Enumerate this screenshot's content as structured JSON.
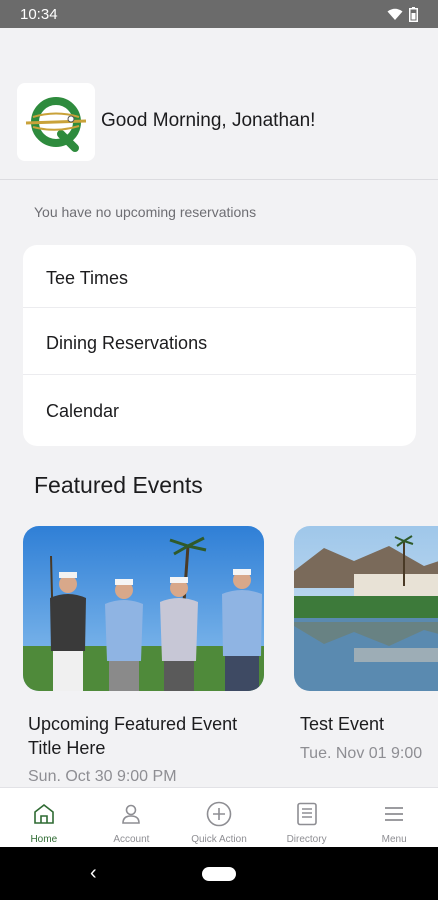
{
  "status_bar": {
    "time": "10:34",
    "icons": [
      "wifi-icon",
      "battery-icon"
    ]
  },
  "header": {
    "greeting": "Good Morning, Jonathan!",
    "logo": "club-logo"
  },
  "reservations": {
    "empty_text": "You have no upcoming reservations"
  },
  "quick_links": [
    {
      "label": "Tee Times"
    },
    {
      "label": "Dining Reservations"
    },
    {
      "label": "Calendar"
    }
  ],
  "featured": {
    "title": "Featured Events",
    "events": [
      {
        "title_line1": "Upcoming Featured Event",
        "title_line2": "Title Here",
        "date": "Sun. Oct 30 9:00 PM"
      },
      {
        "title_line1": "Test Event",
        "title_line2": "",
        "date": "Tue. Nov 01 9:00"
      }
    ]
  },
  "bottom_nav": [
    {
      "label": "Home",
      "icon": "home-icon",
      "active": true
    },
    {
      "label": "Account",
      "icon": "account-icon",
      "active": false
    },
    {
      "label": "Quick Action",
      "icon": "plus-circle-icon",
      "active": false
    },
    {
      "label": "Directory",
      "icon": "directory-icon",
      "active": false
    },
    {
      "label": "Menu",
      "icon": "menu-icon",
      "active": false
    }
  ],
  "colors": {
    "accent": "#2f6b33",
    "logo_gold": "#c9a23a",
    "background": "#f2f2f4"
  }
}
